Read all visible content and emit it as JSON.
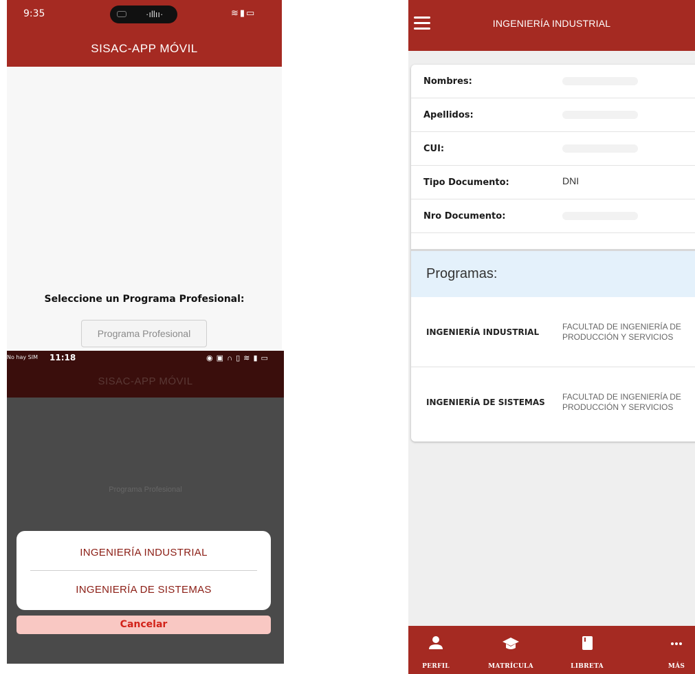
{
  "screen1": {
    "status_time": "9:35",
    "appbar_title": "SISAC-APP MÓVIL",
    "prompt": "Seleccione un Programa Profesional:",
    "program_button": "Programa Profesional"
  },
  "screen2": {
    "status_carrier": "No hay SIM",
    "status_time": "11:18",
    "appbar_title": "SISAC-APP MÓVIL",
    "background_button": "Programa Profesional",
    "options": [
      "INGENIERÍA INDUSTRIAL",
      "INGENIERÍA DE SISTEMAS"
    ],
    "cancel_label": "Cancelar"
  },
  "screen3": {
    "appbar_title": "INGENIERÍA INDUSTRIAL",
    "profile_rows": [
      {
        "label": "Nombres:",
        "value": ""
      },
      {
        "label": "Apellidos:",
        "value": ""
      },
      {
        "label": "CUI:",
        "value": ""
      },
      {
        "label": "Tipo Documento:",
        "value": "DNI"
      },
      {
        "label": "Nro Documento:",
        "value": ""
      }
    ],
    "programs_heading": "Programas:",
    "programs": [
      {
        "name": "INGENIERÍA INDUSTRIAL",
        "faculty": "FACULTAD DE INGENIERÍA DE PRODUCCIÓN Y SERVICIOS"
      },
      {
        "name": "INGENIERÍA DE SISTEMAS",
        "faculty": "FACULTAD DE INGENIERÍA DE PRODUCCIÓN Y SERVICIOS"
      }
    ],
    "tabs": [
      {
        "label": "PERFIL",
        "icon": "person-icon"
      },
      {
        "label": "MATRÍCULA",
        "icon": "graduation-cap-icon"
      },
      {
        "label": "LIBRETA",
        "icon": "notebook-icon"
      },
      {
        "label": "MÁS",
        "icon": "more-dots-icon"
      }
    ]
  },
  "colors": {
    "brand": "#a52a22",
    "dialog_option": "#8b1d14",
    "cancel_bg": "#f9c8c3",
    "cancel_text": "#d2231a",
    "programs_header_bg": "#e4f1fb"
  }
}
